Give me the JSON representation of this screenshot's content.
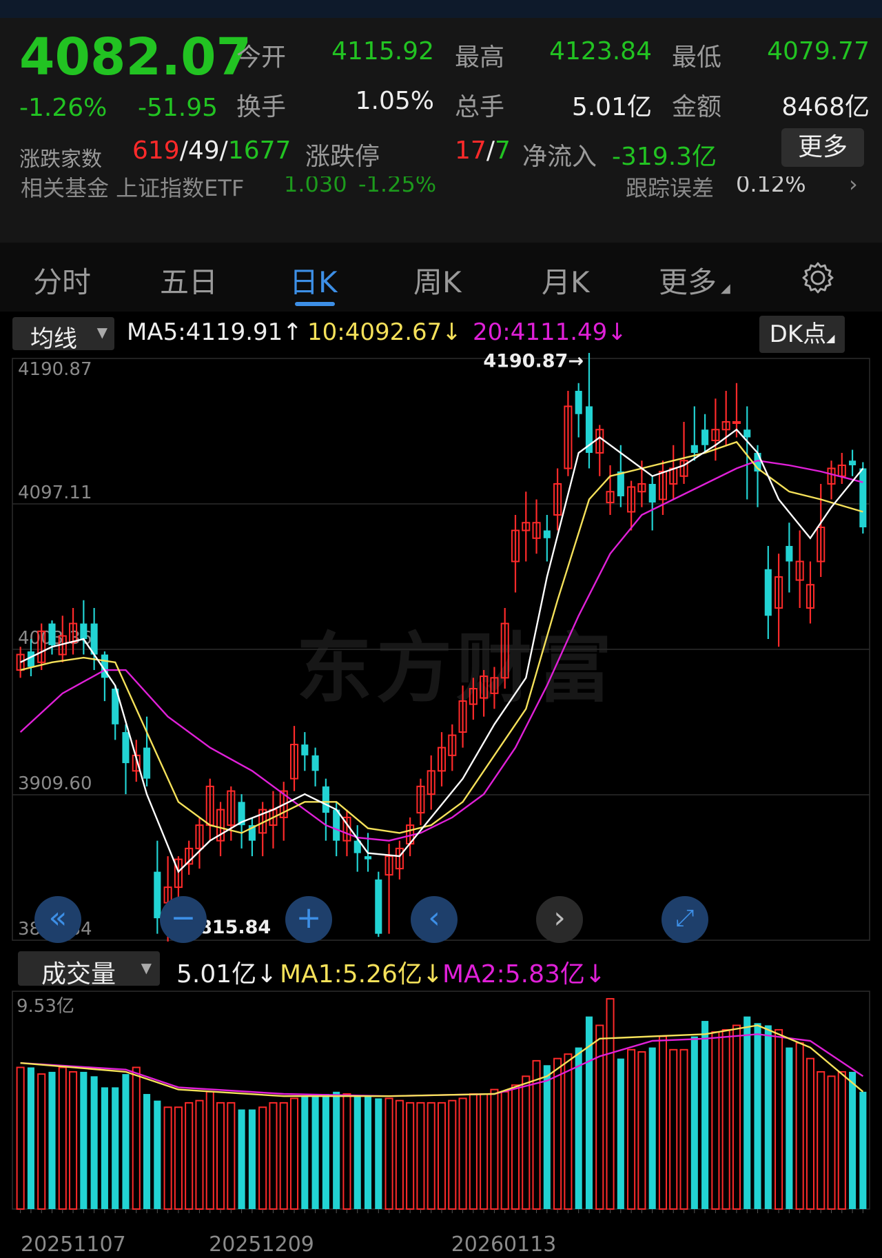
{
  "quote": {
    "price": "4082.07",
    "change_pct": "-1.26%",
    "change": "-51.95",
    "open_label": "今开",
    "open": "4115.92",
    "high_label": "最高",
    "high": "4123.84",
    "low_label": "最低",
    "low": "4079.77",
    "turnover_label": "换手",
    "turnover": "1.05%",
    "volume_label": "总手",
    "volume": "5.01亿",
    "amount_label": "金额",
    "amount": "8468亿",
    "breadth_label": "涨跌家数",
    "up_count": "619",
    "flat_count": "49",
    "down_count": "1677",
    "limit_label": "涨跌停",
    "limit_up": "17",
    "limit_down": "7",
    "inflow_label": "净流入",
    "inflow": "-319.3亿",
    "more_label": "更多",
    "fund_text": "相关基金  上证指数ETF",
    "fund_price": "1.030",
    "fund_pct": "-1.25%",
    "tracking_label": "跟踪误差",
    "tracking_value": "0.12%"
  },
  "tabs": [
    "分时",
    "五日",
    "日K",
    "周K",
    "月K",
    "更多"
  ],
  "active_tab": "日K",
  "chart_controls": {
    "indicator_select": "均线",
    "ma5": "MA5:4119.91↑",
    "ma10": "10:4092.67↓",
    "ma20": "20:4111.49↓",
    "dk_label": "DK点",
    "vol_select": "成交量",
    "vol_value": "5.01亿↓",
    "vol_ma1": "MA1:5.26亿↓",
    "vol_ma2": "MA2:5.83亿↓",
    "high_marker": "4190.87→",
    "low_marker": "←3815.84",
    "watermark": "东方财富"
  },
  "colors": {
    "up": "#ff2a2a",
    "down": "#22d3d3",
    "ma5": "#ffffff",
    "ma10": "#f5e15a",
    "ma20": "#e020d8",
    "accent": "#3d8fe6"
  },
  "chart_data": {
    "type": "candlestick",
    "y_ticks": [
      "4190.87",
      "4097.11",
      "4003.36",
      "3909.60",
      "3815.84"
    ],
    "ylim": [
      3815.84,
      4190.87
    ],
    "x_labels": [
      "20251107",
      "20251209",
      "20260113"
    ],
    "x_label_index": [
      1,
      23,
      46
    ],
    "candles": [
      [
        3990,
        4000,
        3985,
        4005
      ],
      [
        4002,
        3992,
        3986,
        4010
      ],
      [
        3995,
        4015,
        3990,
        4020
      ],
      [
        4020,
        4006,
        4000,
        4022
      ],
      [
        4000,
        4012,
        3995,
        4025
      ],
      [
        4008,
        4020,
        4000,
        4030
      ],
      [
        4020,
        4010,
        4000,
        4035
      ],
      [
        4020,
        4000,
        3990,
        4030
      ],
      [
        4000,
        3985,
        3970,
        4002
      ],
      [
        3978,
        3955,
        3945,
        3980
      ],
      [
        3950,
        3930,
        3910,
        3955
      ],
      [
        3925,
        3935,
        3918,
        3945
      ],
      [
        3940,
        3920,
        3915,
        3960
      ],
      [
        3860,
        3830,
        3820,
        3880
      ],
      [
        3840,
        3850,
        3815,
        3870
      ],
      [
        3850,
        3868,
        3842,
        3870
      ],
      [
        3865,
        3875,
        3858,
        3880
      ],
      [
        3875,
        3890,
        3862,
        3895
      ],
      [
        3890,
        3915,
        3880,
        3920
      ],
      [
        3880,
        3900,
        3870,
        3905
      ],
      [
        3890,
        3912,
        3880,
        3915
      ],
      [
        3905,
        3890,
        3875,
        3910
      ],
      [
        3890,
        3880,
        3870,
        3895
      ],
      [
        3885,
        3900,
        3870,
        3905
      ],
      [
        3890,
        3900,
        3875,
        3912
      ],
      [
        3895,
        3912,
        3880,
        3918
      ],
      [
        3920,
        3942,
        3912,
        3954
      ],
      [
        3942,
        3935,
        3925,
        3950
      ],
      [
        3935,
        3925,
        3915,
        3940
      ],
      [
        3915,
        3898,
        3880,
        3920
      ],
      [
        3900,
        3880,
        3870,
        3905
      ],
      [
        3880,
        3895,
        3870,
        3900
      ],
      [
        3880,
        3872,
        3860,
        3890
      ],
      [
        3870,
        3868,
        3860,
        3885
      ],
      [
        3855,
        3820,
        3818,
        3860
      ],
      [
        3858,
        3870,
        3820,
        3878
      ],
      [
        3862,
        3875,
        3855,
        3880
      ],
      [
        3878,
        3890,
        3870,
        3895
      ],
      [
        3898,
        3915,
        3890,
        3920
      ],
      [
        3910,
        3925,
        3900,
        3935
      ],
      [
        3925,
        3940,
        3915,
        3950
      ],
      [
        3935,
        3948,
        3925,
        3955
      ],
      [
        3950,
        3970,
        3940,
        3980
      ],
      [
        3968,
        3978,
        3958,
        3985
      ],
      [
        3972,
        3986,
        3960,
        3990
      ],
      [
        3975,
        3985,
        3965,
        3992
      ],
      [
        3985,
        4020,
        3978,
        4030
      ],
      [
        4060,
        4080,
        4040,
        4090
      ],
      [
        4080,
        4085,
        4060,
        4105
      ],
      [
        4075,
        4085,
        4065,
        4100
      ],
      [
        4080,
        4075,
        4060,
        4090
      ],
      [
        4090,
        4110,
        4080,
        4120
      ],
      [
        4120,
        4160,
        4115,
        4170
      ],
      [
        4170,
        4155,
        4140,
        4175
      ],
      [
        4160,
        4130,
        4120,
        4195
      ],
      [
        4130,
        4145,
        4115,
        4148
      ],
      [
        4098,
        4105,
        4090,
        4122
      ],
      [
        4118,
        4102,
        4095,
        4135
      ],
      [
        4092,
        4108,
        4080,
        4112
      ],
      [
        4105,
        4110,
        4095,
        4125
      ],
      [
        4110,
        4098,
        4080,
        4115
      ],
      [
        4100,
        4118,
        4090,
        4125
      ],
      [
        4110,
        4120,
        4100,
        4135
      ],
      [
        4115,
        4125,
        4110,
        4150
      ],
      [
        4135,
        4130,
        4125,
        4160
      ],
      [
        4145,
        4135,
        4130,
        4155
      ],
      [
        4138,
        4145,
        4125,
        4165
      ],
      [
        4145,
        4150,
        4135,
        4170
      ],
      [
        4150,
        4150,
        4140,
        4175
      ],
      [
        4145,
        4140,
        4100,
        4160
      ],
      [
        4130,
        4118,
        4095,
        4135
      ],
      [
        4055,
        4025,
        4010,
        4070
      ],
      [
        4030,
        4050,
        4005,
        4065
      ],
      [
        4070,
        4060,
        4040,
        4085
      ],
      [
        4048,
        4060,
        4030,
        4080
      ],
      [
        4030,
        4045,
        4020,
        4060
      ],
      [
        4060,
        4082,
        4050,
        4110
      ],
      [
        4110,
        4120,
        4100,
        4125
      ],
      [
        4115,
        4122,
        4110,
        4130
      ],
      [
        4125,
        4122,
        4115,
        4132
      ],
      [
        4120,
        4082,
        4078,
        4124
      ]
    ],
    "ma5_pts": [
      [
        0,
        3995
      ],
      [
        3,
        4005
      ],
      [
        6,
        4010
      ],
      [
        9,
        3980
      ],
      [
        12,
        3910
      ],
      [
        15,
        3860
      ],
      [
        18,
        3880
      ],
      [
        21,
        3892
      ],
      [
        24,
        3900
      ],
      [
        27,
        3910
      ],
      [
        30,
        3900
      ],
      [
        33,
        3872
      ],
      [
        36,
        3870
      ],
      [
        39,
        3895
      ],
      [
        42,
        3920
      ],
      [
        45,
        3955
      ],
      [
        48,
        3985
      ],
      [
        50,
        4050
      ],
      [
        53,
        4130
      ],
      [
        55,
        4140
      ],
      [
        57,
        4130
      ],
      [
        60,
        4115
      ],
      [
        63,
        4122
      ],
      [
        66,
        4135
      ],
      [
        68,
        4145
      ],
      [
        70,
        4130
      ],
      [
        72,
        4100
      ],
      [
        75,
        4075
      ],
      [
        77,
        4095
      ],
      [
        80,
        4120
      ]
    ],
    "ma10_pts": [
      [
        0,
        3990
      ],
      [
        3,
        3995
      ],
      [
        6,
        3998
      ],
      [
        9,
        3995
      ],
      [
        12,
        3950
      ],
      [
        15,
        3905
      ],
      [
        18,
        3890
      ],
      [
        21,
        3885
      ],
      [
        24,
        3895
      ],
      [
        27,
        3905
      ],
      [
        30,
        3905
      ],
      [
        33,
        3888
      ],
      [
        36,
        3885
      ],
      [
        39,
        3890
      ],
      [
        42,
        3905
      ],
      [
        45,
        3935
      ],
      [
        48,
        3965
      ],
      [
        51,
        4035
      ],
      [
        54,
        4100
      ],
      [
        56,
        4115
      ],
      [
        59,
        4120
      ],
      [
        62,
        4125
      ],
      [
        65,
        4130
      ],
      [
        68,
        4137
      ],
      [
        70,
        4120
      ],
      [
        73,
        4105
      ],
      [
        76,
        4100
      ],
      [
        80,
        4092
      ]
    ],
    "ma20_pts": [
      [
        0,
        3950
      ],
      [
        4,
        3975
      ],
      [
        8,
        3990
      ],
      [
        10,
        3990
      ],
      [
        14,
        3960
      ],
      [
        18,
        3940
      ],
      [
        22,
        3925
      ],
      [
        26,
        3905
      ],
      [
        29,
        3890
      ],
      [
        32,
        3882
      ],
      [
        35,
        3880
      ],
      [
        38,
        3885
      ],
      [
        41,
        3895
      ],
      [
        44,
        3910
      ],
      [
        47,
        3940
      ],
      [
        50,
        3980
      ],
      [
        53,
        4025
      ],
      [
        56,
        4065
      ],
      [
        59,
        4090
      ],
      [
        62,
        4100
      ],
      [
        65,
        4110
      ],
      [
        68,
        4120
      ],
      [
        70,
        4125
      ],
      [
        73,
        4122
      ],
      [
        76,
        4118
      ],
      [
        80,
        4111
      ]
    ],
    "volume": {
      "ylim": [
        0,
        9.53
      ],
      "top_label": "9.53亿",
      "values": [
        6.4,
        6.4,
        6.1,
        6.2,
        6.4,
        6.2,
        6.2,
        6.0,
        5.5,
        5.5,
        6.1,
        6.4,
        5.2,
        4.9,
        4.6,
        4.6,
        4.8,
        4.9,
        5.3,
        4.8,
        4.8,
        4.5,
        4.5,
        4.6,
        4.8,
        4.8,
        5.0,
        5.1,
        5.2,
        5.2,
        5.3,
        5.2,
        5.1,
        5.1,
        5.0,
        5.0,
        4.9,
        4.8,
        4.8,
        4.8,
        4.8,
        4.9,
        5.0,
        5.2,
        5.2,
        5.4,
        5.3,
        5.6,
        6.0,
        6.7,
        6.5,
        6.8,
        7.0,
        7.3,
        8.7,
        8.3,
        9.5,
        6.8,
        7.2,
        7.1,
        7.3,
        7.8,
        7.2,
        7.2,
        7.8,
        8.5,
        8.0,
        8.1,
        8.3,
        8.7,
        8.4,
        8.3,
        8.1,
        7.3,
        7.5,
        6.8,
        6.2,
        6.0,
        6.2,
        6.2,
        5.3
      ],
      "ma1_pts": [
        [
          0,
          6.6
        ],
        [
          10,
          6.2
        ],
        [
          15,
          5.4
        ],
        [
          25,
          5.1
        ],
        [
          35,
          5.1
        ],
        [
          45,
          5.2
        ],
        [
          50,
          6.0
        ],
        [
          55,
          7.7
        ],
        [
          60,
          7.8
        ],
        [
          65,
          7.9
        ],
        [
          70,
          8.3
        ],
        [
          75,
          7.3
        ],
        [
          80,
          5.3
        ]
      ],
      "ma2_pts": [
        [
          0,
          6.6
        ],
        [
          10,
          6.3
        ],
        [
          15,
          5.5
        ],
        [
          25,
          5.2
        ],
        [
          35,
          5.1
        ],
        [
          45,
          5.2
        ],
        [
          50,
          5.8
        ],
        [
          55,
          6.9
        ],
        [
          60,
          7.6
        ],
        [
          65,
          7.7
        ],
        [
          70,
          7.9
        ],
        [
          75,
          7.6
        ],
        [
          80,
          6.0
        ]
      ]
    }
  }
}
